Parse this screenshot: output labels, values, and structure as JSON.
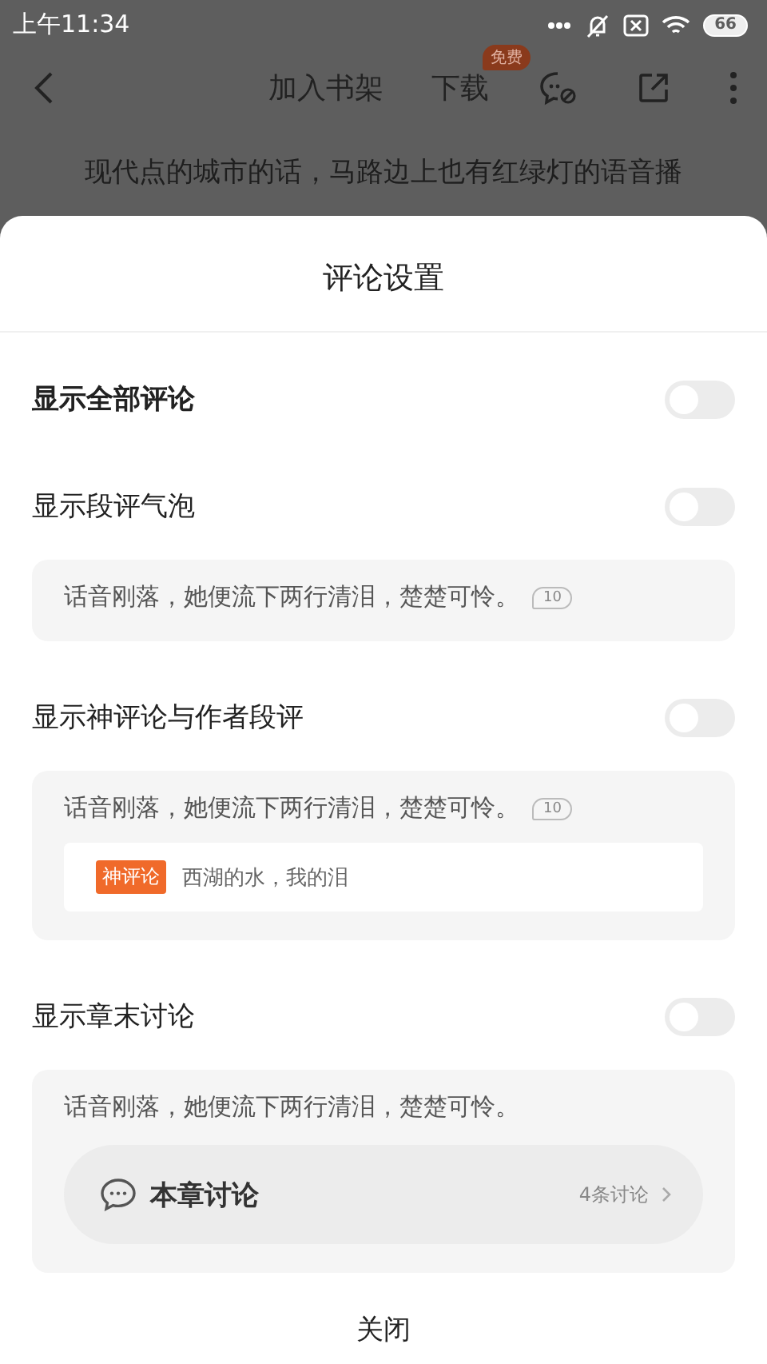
{
  "status_bar": {
    "time": "上午11:34",
    "battery": "66"
  },
  "toolbar": {
    "add_to_shelf": "加入书架",
    "download": "下载",
    "download_badge": "免费"
  },
  "reader_text": "现代点的城市的话，马路边上也有红绿灯的语音播",
  "sheet": {
    "title": "评论设置",
    "settings": [
      {
        "kind": "master",
        "label": "显示全部评论",
        "on": false
      },
      {
        "kind": "bubble",
        "label": "显示段评气泡",
        "on": false,
        "sample": "话音刚落，她便流下两行清泪，楚楚可怜。",
        "count": "10"
      },
      {
        "kind": "god_comment",
        "label": "显示神评论与作者段评",
        "on": false,
        "sample": "话音刚落，她便流下两行清泪，楚楚可怜。",
        "count": "10",
        "tag": "神评论",
        "comment": "西湖的水，我的泪"
      },
      {
        "kind": "chapter",
        "label": "显示章末讨论",
        "on": false,
        "sample": "话音刚落，她便流下两行清泪，楚楚可怜。",
        "discussion_title": "本章讨论",
        "discussion_count": "4条讨论"
      }
    ],
    "close": "关闭"
  }
}
